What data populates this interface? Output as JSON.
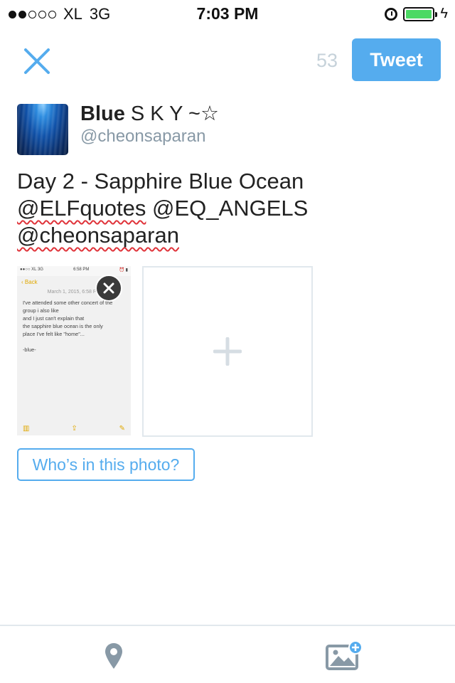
{
  "status_bar": {
    "signal_dots_filled": 2,
    "signal_dots_total": 5,
    "carrier": "XL",
    "network": "3G",
    "time": "7:03 PM",
    "battery_level": 1.0,
    "battery_color": "#4cd964"
  },
  "header": {
    "close_icon": "close-icon",
    "char_count": "53",
    "tweet_label": "Tweet",
    "accent_color": "#55acee"
  },
  "user": {
    "name_bold": "Blue",
    "name_rest": "S K Y  ~☆",
    "handle": "@cheonsaparan"
  },
  "tweet": {
    "line1": "Day 2 - Sapphire Blue Ocean",
    "mention1": "@ELFquotes",
    "mention2": "@EQ_ANGELS",
    "mention3": "@cheonsaparan"
  },
  "attachment": {
    "mini_status_left": "●●○○ XL  3G",
    "mini_status_time": "6:58 PM",
    "mini_status_right": "⏰ ▮",
    "back_label": "Back",
    "date": "March 1, 2015, 6:58 PM",
    "body": "I've attended some other concert of the\ngroup i also like\nand I just can't explain that\nthe sapphire blue ocean is the only\nplace I've felt like \"home\"...\n\n-blue-",
    "toolbar_icons": [
      "trash-icon",
      "share-icon",
      "compose-icon"
    ]
  },
  "tag_button_label": "Who’s in this photo?",
  "toolbar": {
    "icons": [
      "location-pin-icon",
      "add-photo-icon"
    ],
    "icon_color": "#8899a6"
  }
}
